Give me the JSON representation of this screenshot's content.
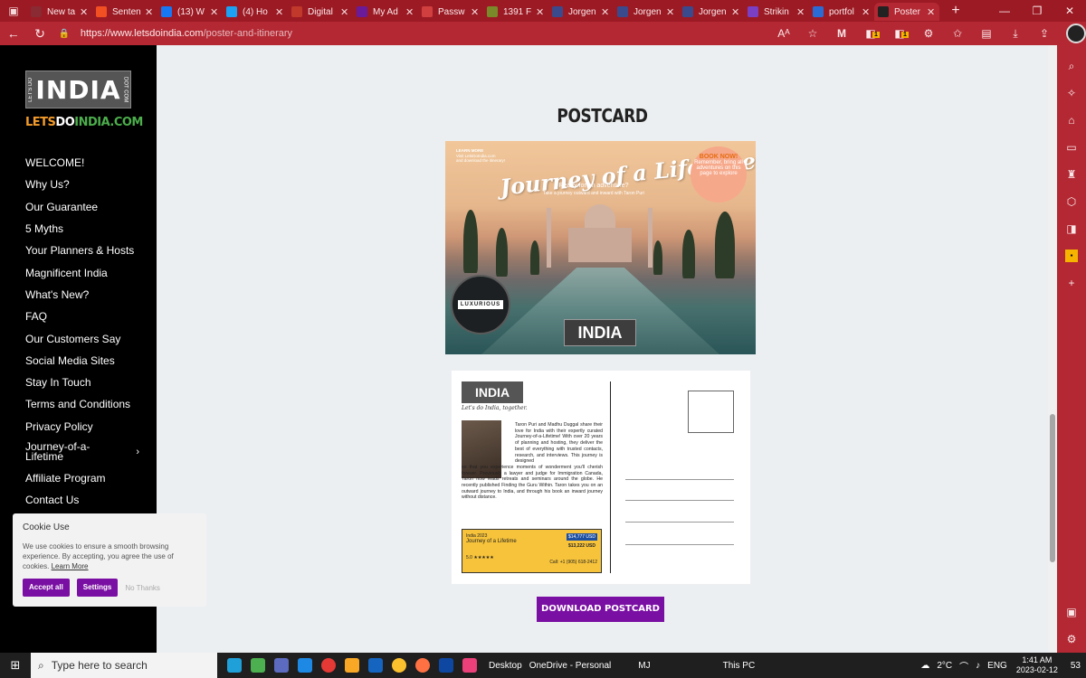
{
  "browser": {
    "tabs": [
      {
        "label": "New ta",
        "color": "#8a2a32"
      },
      {
        "label": "Senten",
        "color": "#f25022"
      },
      {
        "label": "(13) W",
        "color": "#1877f2"
      },
      {
        "label": "(4) Ho",
        "color": "#1da1f2"
      },
      {
        "label": "Digital",
        "color": "#c0392b"
      },
      {
        "label": "My Ad",
        "color": "#6a1b9a"
      },
      {
        "label": "Passw",
        "color": "#d23f3f"
      },
      {
        "label": "1391 F",
        "color": "#7a8a2a"
      },
      {
        "label": "Jorgen",
        "color": "#3b4a8c"
      },
      {
        "label": "Jorgen",
        "color": "#3b4a8c"
      },
      {
        "label": "Jorgen",
        "color": "#3b4a8c"
      },
      {
        "label": "Strikin",
        "color": "#7b3fc4"
      },
      {
        "label": "portfol",
        "color": "#2b6cd4"
      },
      {
        "label": "Poster",
        "color": "#222222",
        "active": true
      }
    ],
    "url_host": "https://www.letsdoindia.com",
    "url_path": "/poster-and-itinerary",
    "badge_1": "1",
    "badge_2": "1",
    "icons": [
      "back-icon",
      "refresh-icon",
      "lock-icon",
      "read-aloud-icon",
      "add-favorite-icon",
      "extensions-icon",
      "collections-icon",
      "downloads-icon",
      "share-icon"
    ]
  },
  "site": {
    "logo_main": "INDIA",
    "logo_left": "LET'S DO",
    "logo_right": "DOT COM",
    "name_part1": "LETS",
    "name_part2": "DO",
    "name_part3": "INDIA.COM",
    "menu": [
      "WELCOME!",
      "Why Us?",
      "Our Guarantee",
      "5 Myths",
      "Your Planners & Hosts",
      "Magnificent India",
      "What's New?",
      "FAQ",
      "Our Customers Say",
      "Social Media Sites",
      "Stay In Touch",
      "Terms and Conditions",
      "Privacy Policy",
      "Journey-of-a-Lifetime",
      "Affiliate Program",
      "Contact Us"
    ],
    "brand_colors": {
      "orange": "#f29b2c",
      "green": "#4cae4c",
      "purple": "#7a0fa3"
    }
  },
  "cookie": {
    "title": "Cookie Use",
    "text": "We use cookies to ensure a smooth browsing experience. By accepting, you agree the use of cookies.",
    "learn_more": "Learn More",
    "accept": "Accept all",
    "settings": "Settings",
    "no_thanks": "No Thanks"
  },
  "main": {
    "section_title": "POSTCARD",
    "front": {
      "title": "Journey of a Lifetime",
      "learn_more_1": "LEARN MORE",
      "learn_more_2": "Visit LetsDoIndia.com",
      "learn_more_3": "and download the itinerary!",
      "book_now": "BOOK NOW!",
      "book_text": "Remember, bring all adventures on this page to explore",
      "adventure": "Ready for an adventure?",
      "adventure_sub": "Take a journey outward and inward with Taron Puri",
      "badge": "LUXURIOUS",
      "logo": "INDIA"
    },
    "back": {
      "logo": "INDIA",
      "tagline": "Let's do India, together.",
      "bio_1": "Taron Puri and Madhu Duggal share their love for India with their expertly curated Journey-of-a-Lifetime! With over 20 years of planning and hosting, they deliver the best of everything with trusted contacts, research, and interviews. This journey is designed",
      "bio_2": "so that you experience moments of wonderment you'll cherish forever. Previously a lawyer and judge for Immigration Canada, Taron now leads retreats and seminars around the globe. He recently published Finding the Guru Within. Taron takes you on an outward journey to India, and through his book an inward journey without distance.",
      "ad_title": "India 2023",
      "ad_subtitle": "Journey of a Lifetime",
      "ad_price1": "$14,777 USD",
      "ad_price2": "$13,222 USD",
      "ad_rating": "5.0 ★★★★★",
      "ad_contact": "Call: +1 (905) 618-2412"
    },
    "download_label": "DOWNLOAD POSTCARD"
  },
  "taskbar": {
    "search_placeholder": "Type here to search",
    "desktop_label": "Desktop",
    "onedrive_label": "OneDrive - Personal",
    "user_label": "MJ",
    "thispc_label": "This PC",
    "temperature": "2°C",
    "language": "ENG",
    "time": "1:41 AM",
    "date": "2023-02-12",
    "notification_count": "53"
  }
}
